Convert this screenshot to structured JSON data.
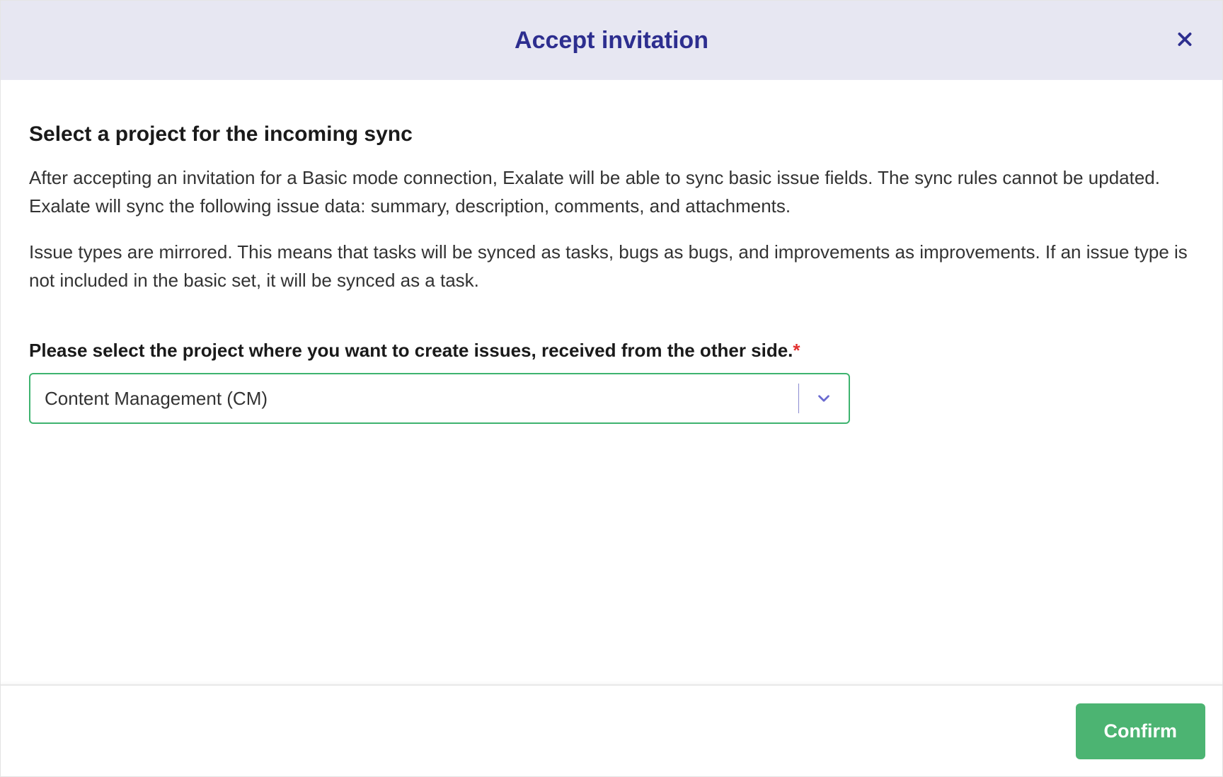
{
  "modal": {
    "title": "Accept invitation",
    "body": {
      "heading": "Select a project for the incoming sync",
      "paragraph1": "After accepting an invitation for a Basic mode connection, Exalate will be able to sync basic issue fields. The sync rules cannot be updated. Exalate will sync the following issue data: summary, description, comments, and attachments.",
      "paragraph2": "Issue types are mirrored. This means that tasks will be synced as tasks, bugs as bugs, and improvements as improvements. If an issue type is not included in the basic set, it will be synced as a task.",
      "field_label": "Please select the project where you want to create issues, received from the other side.",
      "required_marker": "*",
      "project_select": {
        "selected": "Content Management (CM)"
      }
    },
    "footer": {
      "confirm_label": "Confirm"
    }
  }
}
